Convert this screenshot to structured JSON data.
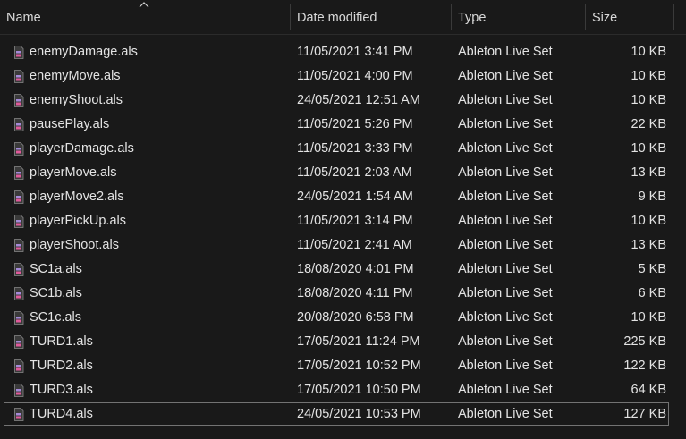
{
  "columns": {
    "name": "Name",
    "date": "Date modified",
    "type": "Type",
    "size": "Size"
  },
  "files": [
    {
      "name": "enemyDamage.als",
      "date": "11/05/2021 3:41 PM",
      "type": "Ableton Live Set",
      "size": "10 KB"
    },
    {
      "name": "enemyMove.als",
      "date": "11/05/2021 4:00 PM",
      "type": "Ableton Live Set",
      "size": "10 KB"
    },
    {
      "name": "enemyShoot.als",
      "date": "24/05/2021 12:51 AM",
      "type": "Ableton Live Set",
      "size": "10 KB"
    },
    {
      "name": "pausePlay.als",
      "date": "11/05/2021 5:26 PM",
      "type": "Ableton Live Set",
      "size": "22 KB"
    },
    {
      "name": "playerDamage.als",
      "date": "11/05/2021 3:33 PM",
      "type": "Ableton Live Set",
      "size": "10 KB"
    },
    {
      "name": "playerMove.als",
      "date": "11/05/2021 2:03 AM",
      "type": "Ableton Live Set",
      "size": "13 KB"
    },
    {
      "name": "playerMove2.als",
      "date": "24/05/2021 1:54 AM",
      "type": "Ableton Live Set",
      "size": "9 KB"
    },
    {
      "name": "playerPickUp.als",
      "date": "11/05/2021 3:14 PM",
      "type": "Ableton Live Set",
      "size": "10 KB"
    },
    {
      "name": "playerShoot.als",
      "date": "11/05/2021 2:41 AM",
      "type": "Ableton Live Set",
      "size": "13 KB"
    },
    {
      "name": "SC1a.als",
      "date": "18/08/2020 4:01 PM",
      "type": "Ableton Live Set",
      "size": "5 KB"
    },
    {
      "name": "SC1b.als",
      "date": "18/08/2020 4:11 PM",
      "type": "Ableton Live Set",
      "size": "6 KB"
    },
    {
      "name": "SC1c.als",
      "date": "20/08/2020 6:58 PM",
      "type": "Ableton Live Set",
      "size": "10 KB"
    },
    {
      "name": "TURD1.als",
      "date": "17/05/2021 11:24 PM",
      "type": "Ableton Live Set",
      "size": "225 KB"
    },
    {
      "name": "TURD2.als",
      "date": "17/05/2021 10:52 PM",
      "type": "Ableton Live Set",
      "size": "122 KB"
    },
    {
      "name": "TURD3.als",
      "date": "17/05/2021 10:50 PM",
      "type": "Ableton Live Set",
      "size": "64 KB"
    },
    {
      "name": "TURD4.als",
      "date": "24/05/2021 10:53 PM",
      "type": "Ableton Live Set",
      "size": "127 KB",
      "selected": true
    }
  ],
  "icon": "ableton-file-icon",
  "sort": {
    "column": "name",
    "direction": "ascending",
    "icon": "sort-up-chevron-icon"
  },
  "colors": {
    "background": "#191919",
    "text": "#e3e3e3",
    "icon_purple": "#a58ad8",
    "icon_pink": "#e05a9a",
    "selection_border": "#737373"
  }
}
